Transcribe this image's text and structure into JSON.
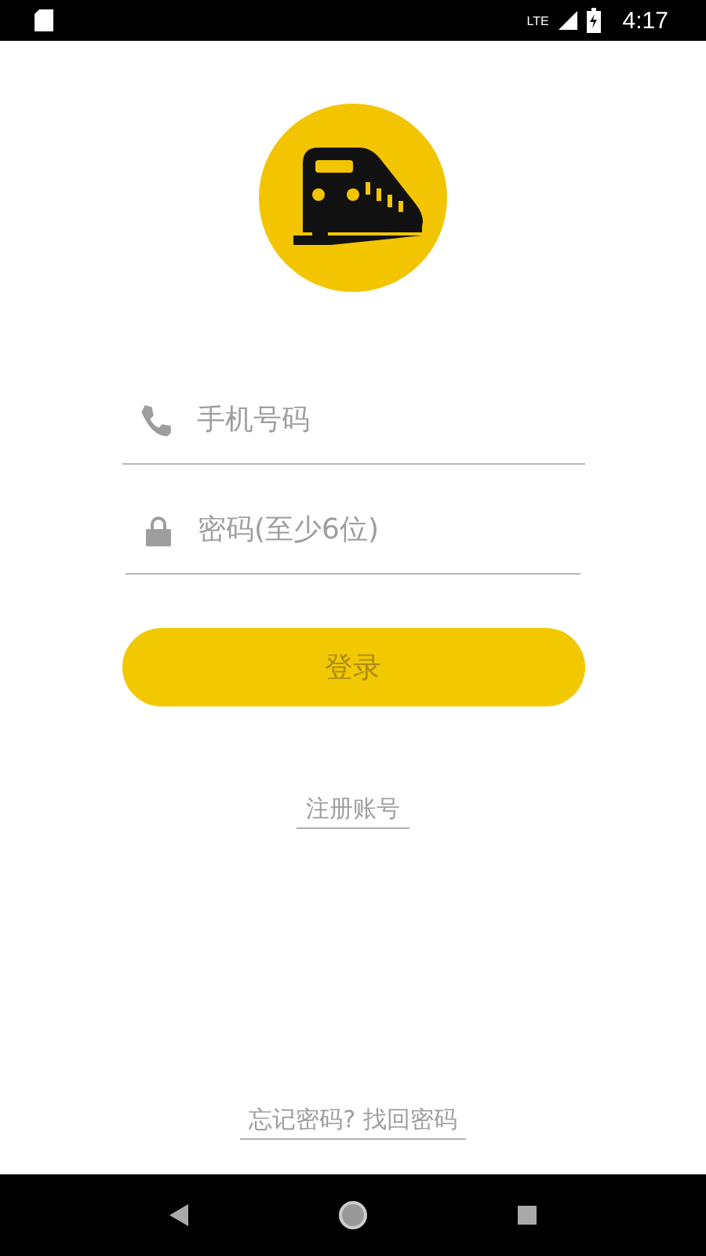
{
  "status_bar": {
    "network": "LTE",
    "time": "4:17"
  },
  "login_form": {
    "phone_field": {
      "placeholder": "手机号码"
    },
    "password_field": {
      "placeholder": "密码(至少6位)"
    },
    "login_button": {
      "label": "登录"
    },
    "register_link": "注册账号",
    "forgot_link": "忘记密码? 找回密码"
  }
}
